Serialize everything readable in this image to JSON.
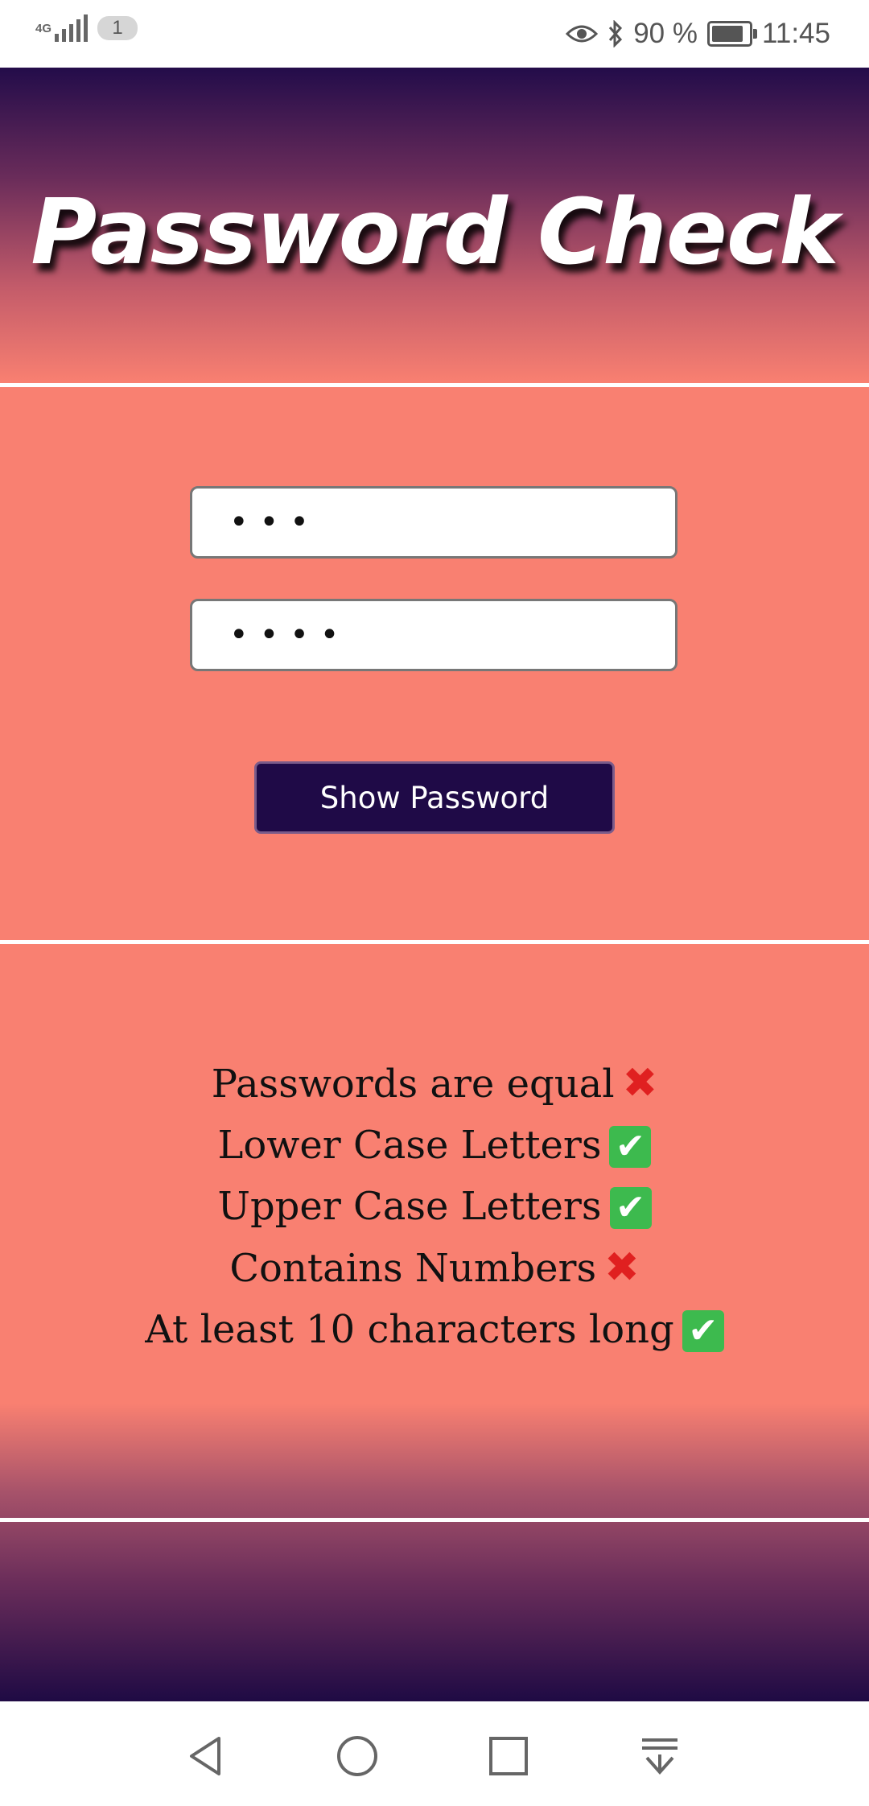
{
  "status_bar": {
    "network": "4G",
    "sim_badge": "1",
    "battery": "90 %",
    "time": "11:45",
    "icons": [
      "signal-icon",
      "eye-icon",
      "bluetooth-icon",
      "battery-icon"
    ]
  },
  "app": {
    "title": "Password Check",
    "password_field_1": {
      "value": "•••"
    },
    "password_field_2": {
      "value": "••••"
    },
    "show_button_label": "Show Password",
    "checks": [
      {
        "label": "Passwords are equal",
        "passed": false,
        "icon": "cross-mark-icon"
      },
      {
        "label": "Lower Case Letters",
        "passed": true,
        "icon": "check-mark-icon"
      },
      {
        "label": "Upper Case Letters",
        "passed": true,
        "icon": "check-mark-icon"
      },
      {
        "label": "Contains Numbers",
        "passed": false,
        "icon": "cross-mark-icon"
      },
      {
        "label": "At least 10 characters long",
        "passed": true,
        "icon": "check-mark-icon"
      }
    ],
    "colors": {
      "background": "#f98071",
      "header_dark": "#230c4a",
      "button": "#1f0a47",
      "check_green": "#3dba4e",
      "cross_red": "#e02020"
    }
  },
  "nav_bar": {
    "icons": [
      "back-icon",
      "home-icon",
      "recent-apps-icon",
      "notification-shade-icon"
    ]
  }
}
